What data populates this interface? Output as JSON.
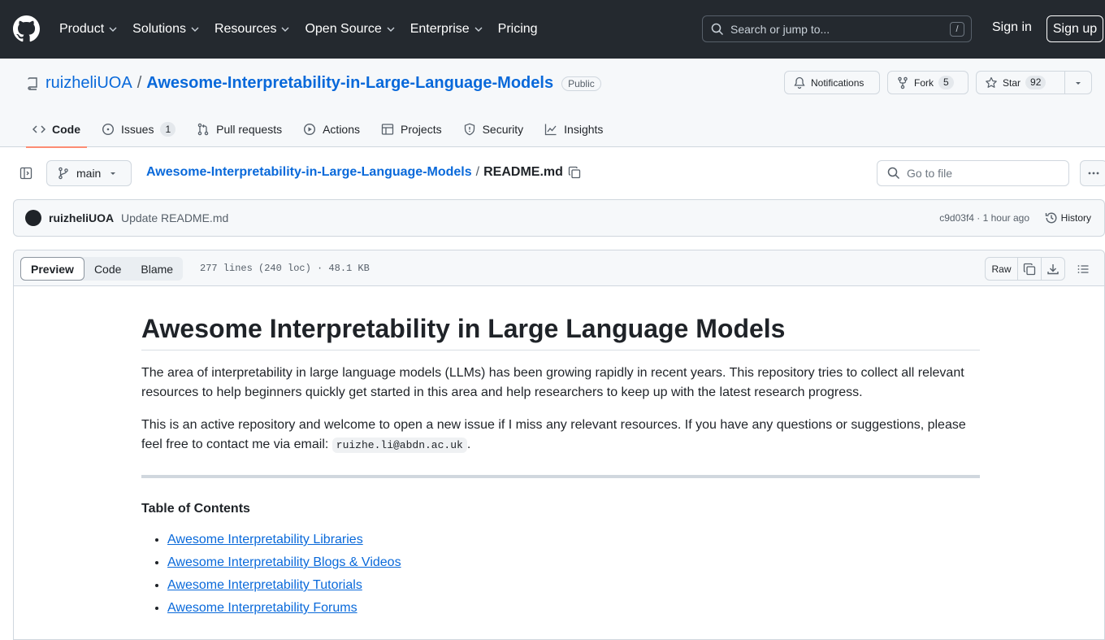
{
  "header": {
    "nav": [
      "Product",
      "Solutions",
      "Resources",
      "Open Source",
      "Enterprise",
      "Pricing"
    ],
    "search_placeholder": "Search or jump to...",
    "search_shortcut": "/",
    "sign_in": "Sign in",
    "sign_up": "Sign up"
  },
  "repo": {
    "owner": "ruizheliUOA",
    "separator": "/",
    "name": "Awesome-Interpretability-in-Large-Language-Models",
    "visibility": "Public",
    "notifications_label": "Notifications",
    "fork_label": "Fork",
    "fork_count": "5",
    "star_label": "Star",
    "star_count": "92"
  },
  "tabs": [
    {
      "label": "Code",
      "icon": "code-icon"
    },
    {
      "label": "Issues",
      "icon": "issue-icon",
      "count": "1"
    },
    {
      "label": "Pull requests",
      "icon": "pull-request-icon"
    },
    {
      "label": "Actions",
      "icon": "play-icon"
    },
    {
      "label": "Projects",
      "icon": "table-icon"
    },
    {
      "label": "Security",
      "icon": "shield-icon"
    },
    {
      "label": "Insights",
      "icon": "graph-icon"
    }
  ],
  "file_nav": {
    "branch": "main",
    "breadcrumb_repo": "Awesome-Interpretability-in-Large-Language-Models",
    "breadcrumb_sep": "/",
    "file_name": "README.md",
    "goto_placeholder": "Go to file"
  },
  "commit": {
    "author": "ruizheliUOA",
    "message": "Update README.md",
    "meta": "c9d03f4 · 1 hour ago",
    "history_label": "History"
  },
  "file_toolbar": {
    "views": [
      "Preview",
      "Code",
      "Blame"
    ],
    "info": "277 lines (240 loc) · 48.1 KB",
    "raw_label": "Raw"
  },
  "readme": {
    "title": "Awesome Interpretability in Large Language Models",
    "para1": "The area of interpretability in large language models (LLMs) has been growing rapidly in recent years. This repository tries to collect all relevant resources to help beginners quickly get started in this area and help researchers to keep up with the latest research progress.",
    "para2_text": "This is an active repository and welcome to open a new issue if I miss any relevant resources. If you have any questions or suggestions, please feel free to contact me via email: ",
    "email": "ruizhe.li@abdn.ac.uk",
    "para2_end": ".",
    "toc_title": "Table of Contents",
    "toc": [
      "Awesome Interpretability Libraries",
      "Awesome Interpretability Blogs & Videos",
      "Awesome Interpretability Tutorials",
      "Awesome Interpretability Forums"
    ]
  },
  "colors": {
    "header_bg": "#24292f",
    "link": "#0969da",
    "tab_underline": "#fd8c73",
    "border": "#d0d7de"
  }
}
